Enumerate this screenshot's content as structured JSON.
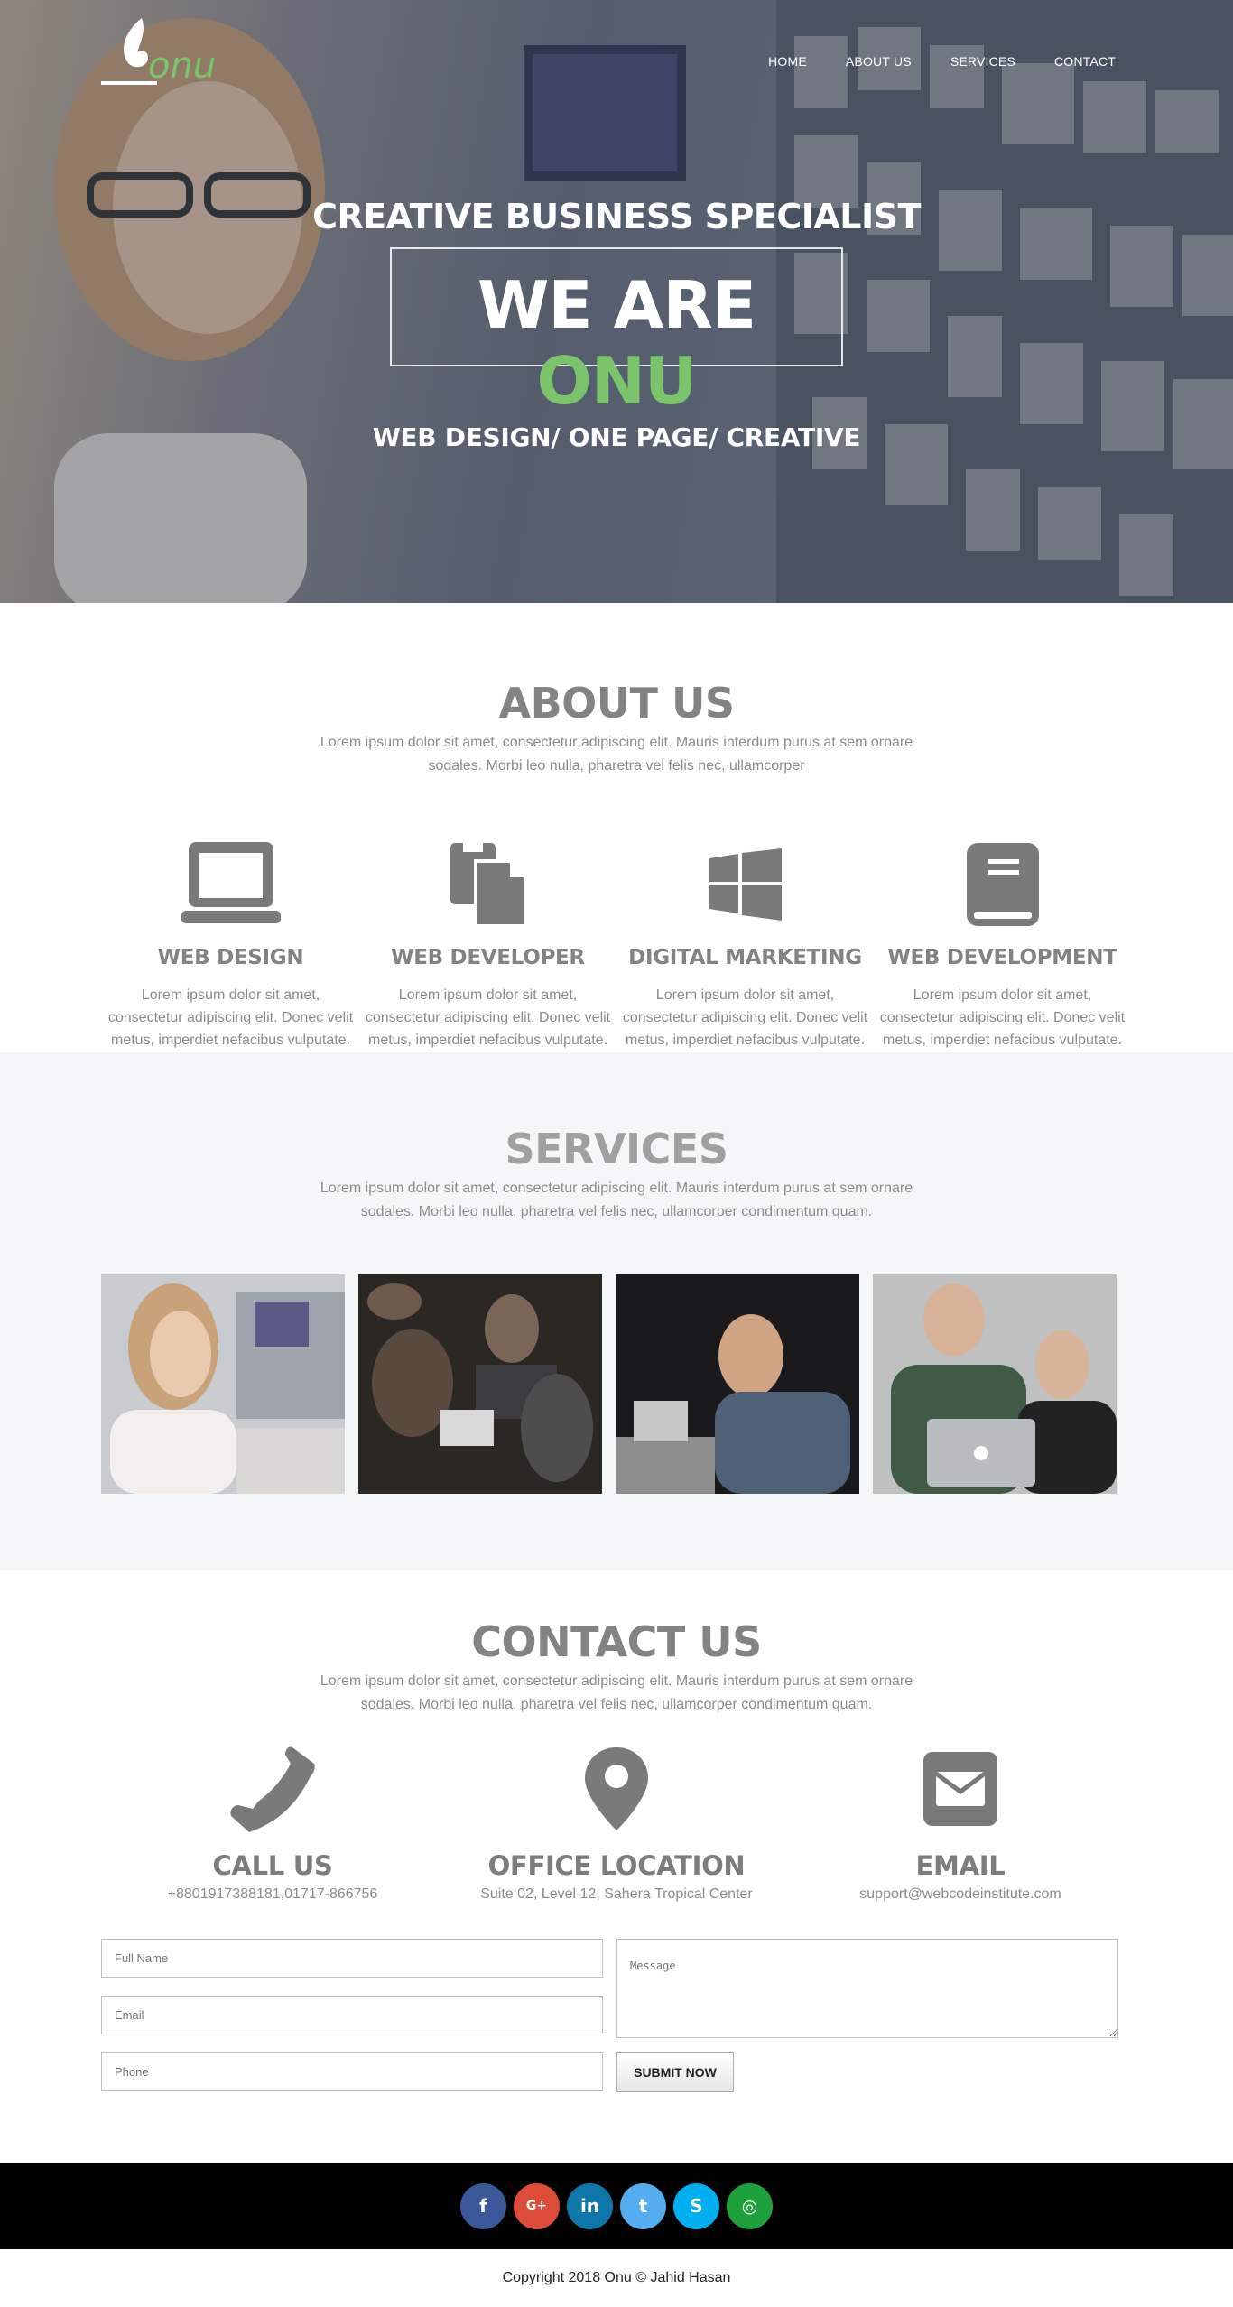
{
  "brand": {
    "name": "onu",
    "accent_color": "#7bc46b"
  },
  "nav": [
    {
      "label": "HOME"
    },
    {
      "label": "ABOUT US"
    },
    {
      "label": "SERVICES"
    },
    {
      "label": "CONTACT"
    }
  ],
  "hero": {
    "kicker": "CREATIVE BUSINESS SPECIALIST",
    "headline_prefix": "WE ARE ",
    "headline_accent": "ONU",
    "subheading": "WEB DESIGN/ ONE PAGE/ CREATIVE"
  },
  "about": {
    "title": "ABOUT US",
    "description": "Lorem ipsum dolor sit amet, consectetur adipiscing elit. Mauris interdum purus at sem ornare sodales. Morbi leo nulla, pharetra vel felis nec, ullamcorper",
    "features": [
      {
        "icon": "laptop-icon",
        "title": "WEB DESIGN",
        "text": "Lorem ipsum dolor sit amet, consectetur adipiscing elit. Donec velit metus, imperdiet nefacibus vulputate."
      },
      {
        "icon": "files-icon",
        "title": "WEB DEVELOPER",
        "text": "Lorem ipsum dolor sit amet, consectetur adipiscing elit. Donec velit metus, imperdiet nefacibus vulputate."
      },
      {
        "icon": "windows-icon",
        "title": "DIGITAL MARKETING",
        "text": "Lorem ipsum dolor sit amet, consectetur adipiscing elit. Donec velit metus, imperdiet nefacibus vulputate."
      },
      {
        "icon": "book-icon",
        "title": "WEB DEVELOPMENT",
        "text": "Lorem ipsum dolor sit amet, consectetur adipiscing elit. Donec velit metus, imperdiet nefacibus vulputate."
      }
    ]
  },
  "services": {
    "title": "SERVICES",
    "description": "Lorem ipsum dolor sit amet, consectetur adipiscing elit. Mauris interdum purus at sem ornare sodales. Morbi leo nulla, pharetra vel felis nec, ullamcorper condimentum quam."
  },
  "contact": {
    "title": "CONTACT US",
    "description": "Lorem ipsum dolor sit amet, consectetur adipiscing elit. Mauris interdum purus at sem ornare sodales. Morbi leo nulla, pharetra vel felis nec, ullamcorper condimentum quam.",
    "cards": [
      {
        "icon": "phone-icon",
        "title": "CALL US",
        "value": "+8801917388181,01717-866756"
      },
      {
        "icon": "map-pin-icon",
        "title": "OFFICE LOCATION",
        "value": "Suite 02, Level 12, Sahera Tropical Center"
      },
      {
        "icon": "envelope-icon",
        "title": "EMAIL",
        "value": "support@webcodeinstitute.com"
      }
    ],
    "form": {
      "full_name_placeholder": "Full Name",
      "email_placeholder": "Email",
      "phone_placeholder": "Phone",
      "message_placeholder": "Message",
      "submit_label": "SUBMIT NOW"
    }
  },
  "footer": {
    "social": [
      {
        "name": "facebook-icon",
        "glyph": "f",
        "color": "#3b5998"
      },
      {
        "name": "google-plus-icon",
        "glyph": "G+",
        "color": "#dd4b39"
      },
      {
        "name": "linkedin-icon",
        "glyph": "in",
        "color": "#0e76a8"
      },
      {
        "name": "twitter-icon",
        "glyph": "t",
        "color": "#55acee"
      },
      {
        "name": "skype-icon",
        "glyph": "S",
        "color": "#00aff0"
      },
      {
        "name": "dribbble-icon",
        "glyph": "◎",
        "color": "#1ca13b"
      }
    ],
    "copyright": "Copyright 2018 Onu © Jahid Hasan"
  }
}
